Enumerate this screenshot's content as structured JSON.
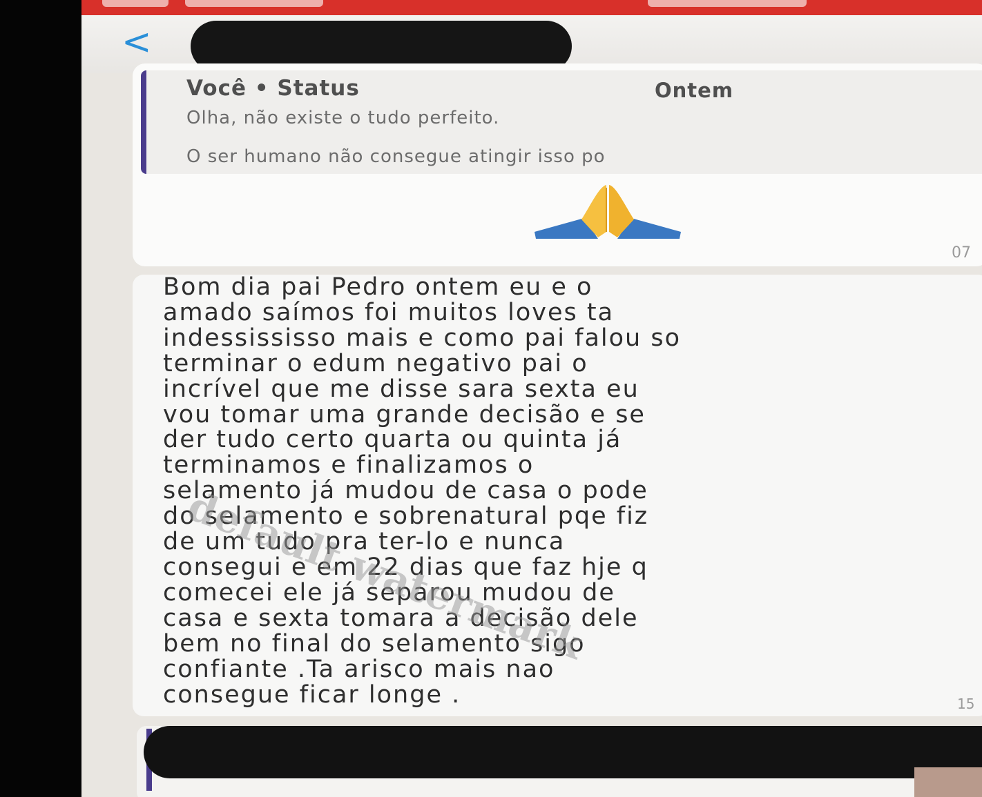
{
  "header": {
    "back_label": "<"
  },
  "quoted_status": {
    "author": "Você • Status",
    "date": "Ontem",
    "line1": "Olha, não existe o tudo perfeito.",
    "line2": "O ser humano não consegue atingir isso po",
    "reaction_icon": "praying-hands-icon",
    "time_partial": "07"
  },
  "message": {
    "lines": [
      "Bom dia pai Pedro ontem eu e o",
      "amado saímos foi muitos loves ta",
      "indessississo mais e como pai falou so",
      "terminar o edum negativo pai o",
      "incrível que me disse sara sexta eu",
      "vou tomar uma grande decisão e se",
      "der tudo certo quarta ou quinta já",
      "terminamos e finalizamos o",
      "selamento já mudou de casa o pode",
      "do selamento e sobrenatural pqe fiz",
      "de um tudo pra ter-lo e nunca",
      "consegui e em 22 dias que faz hje q",
      "comecei ele já separou mudou de",
      "casa e sexta tomara a decisão dele",
      "bem no final do selamento sigo",
      "confiante .Ta arisco mais nao",
      "consegue ficar longe ."
    ],
    "time_partial": "15"
  },
  "watermark": "default watermark",
  "colors": {
    "status_bar": "#d8302a",
    "accent_blue": "#2a8fd8",
    "quote_bar": "#4a3c8c",
    "redaction": "#151515"
  }
}
